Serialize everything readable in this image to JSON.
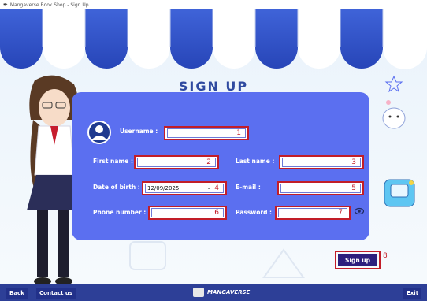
{
  "window": {
    "title": "Mangaverse Book Shop - Sign Up"
  },
  "page": {
    "heading": "SIGN UP"
  },
  "form": {
    "username": {
      "label": "Username :",
      "value": "",
      "badge": "1"
    },
    "first_name": {
      "label": "First name :",
      "value": "",
      "badge": "2"
    },
    "last_name": {
      "label": "Last name :",
      "value": "",
      "badge": "3"
    },
    "dob": {
      "label": "Date of birth :",
      "value": "12/09/2025",
      "badge": "4"
    },
    "email": {
      "label": "E-mail :",
      "value": "",
      "badge": "5"
    },
    "phone": {
      "label": "Phone number :",
      "value": "",
      "badge": "6"
    },
    "password": {
      "label": "Password :",
      "value": "",
      "badge": "7"
    },
    "signup": {
      "label": "Sign up",
      "badge": "8"
    }
  },
  "footer": {
    "back": "Back",
    "contact": "Contact us",
    "logo": "MANGAVERSE",
    "exit": "Exit"
  },
  "colors": {
    "panel": "#5b6ff0",
    "heading": "#2f4aa0",
    "highlight": "#c21d28",
    "button": "#2d1f7d",
    "footer": "#2d3f97"
  }
}
